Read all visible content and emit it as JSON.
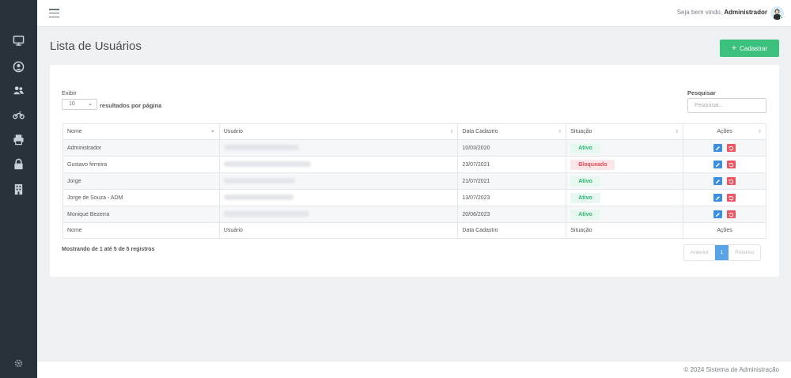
{
  "sidebar": {
    "icons": [
      "monitor-icon",
      "user-circle-icon",
      "users-icon",
      "motorcycle-icon",
      "printer-icon",
      "lock-icon",
      "building-icon"
    ],
    "bottom_icon": "gear-icon"
  },
  "header": {
    "welcome_prefix": "Seja bem vindo,",
    "username": "Administrador"
  },
  "page": {
    "title": "Lista de Usuários",
    "add_button": "Cadastrar"
  },
  "table_controls": {
    "show_label": "Exibir",
    "page_size": "10",
    "per_page_label": "resultados por página",
    "search_label": "Pesquisar",
    "search_placeholder": "Pesquisar..."
  },
  "table": {
    "columns": [
      "Nome",
      "Usuário",
      "Data Cadastro",
      "Situação",
      "Ações"
    ],
    "rows": [
      {
        "name": "Administrador",
        "date": "10/03/2020",
        "status": "Ativo"
      },
      {
        "name": "Gustavo ferreira",
        "date": "23/07/2021",
        "status": "Bloqueado"
      },
      {
        "name": "Jorge",
        "date": "21/07/2021",
        "status": "Ativo"
      },
      {
        "name": "Jorge de Souza - ADM",
        "date": "13/07/2023",
        "status": "Ativo"
      },
      {
        "name": "Monique Bezerra",
        "date": "20/06/2023",
        "status": "Ativo"
      }
    ]
  },
  "pagination": {
    "summary": "Mostrando de 1 até 5 de 5 registros",
    "previous": "Anterior",
    "current": "1",
    "next": "Próximo"
  },
  "footer": {
    "copyright": "© 2024 Sistema de Administração"
  },
  "colors": {
    "sidebar": "#27323b",
    "primary_green": "#3cc07e",
    "edit_blue": "#3b8ee0",
    "reset_red": "#ef5462",
    "active_status": "#2fb46f",
    "blocked_status": "#e04a55"
  }
}
